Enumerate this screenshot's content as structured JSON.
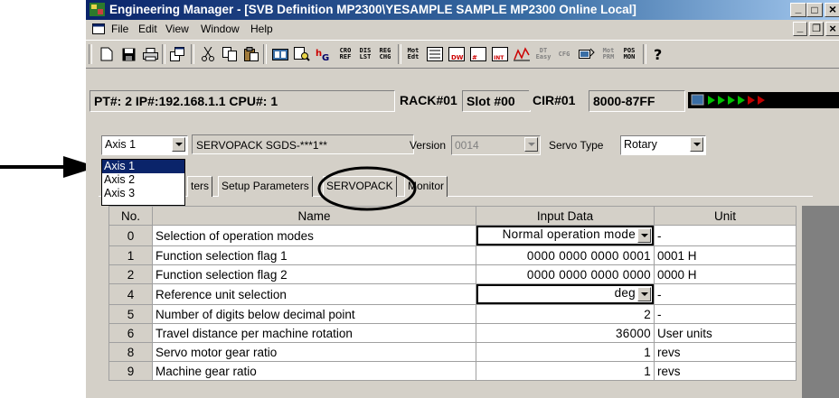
{
  "window": {
    "title": "Engineering Manager - [SVB Definition   MP2300\\YESAMPLE SAMPLE MP2300   Online Local]",
    "controls": {
      "minimize": "_",
      "maximize": "□",
      "close": "×"
    },
    "mdi_controls": {
      "minimize": "_",
      "restore": "❐",
      "close": "×"
    }
  },
  "menu": [
    "File",
    "Edit",
    "View",
    "Window",
    "Help"
  ],
  "toolbar": {
    "labels": {
      "cro_ref": [
        "CRO",
        "REF"
      ],
      "dis_lst": [
        "DIS",
        "LST"
      ],
      "reg_chg": [
        "REG",
        "CHG"
      ],
      "mot_edt": [
        "Mot",
        "Edt"
      ],
      "dt_easy": [
        "DT",
        "Easy"
      ],
      "cfg": "CFG",
      "mot_prm": [
        "Mot",
        "PRM"
      ],
      "pos_mon": [
        "POS",
        "MON"
      ]
    }
  },
  "status": {
    "pt_ip_cpu": "PT#: 2 IP#:192.168.1.1 CPU#: 1",
    "rack": "RACK#01",
    "slot": "Slot #00",
    "cir": "CIR#01",
    "address": "8000-87FF"
  },
  "axis_select": {
    "value": "Axis 1",
    "options": [
      "Axis 1",
      "Axis 2",
      "Axis 3"
    ]
  },
  "servopack_model": "SERVOPACK SGDS-***1**",
  "version": {
    "label": "Version",
    "value": "0014"
  },
  "servo_type": {
    "label": "Servo Type",
    "value": "Rotary"
  },
  "tabs": [
    "ters",
    "Setup Parameters",
    "SERVOPACK",
    "Monitor"
  ],
  "table": {
    "headers": [
      "No.",
      "Name",
      "Input Data",
      "Unit"
    ],
    "rows": [
      {
        "no": "0",
        "name": "Selection of operation modes",
        "input": "Normal operation mode",
        "unit": "-"
      },
      {
        "no": "1",
        "name": "Function selection flag 1",
        "input": "0000 0000 0000 0001",
        "unit": "0001 H"
      },
      {
        "no": "2",
        "name": "Function selection flag 2",
        "input": "0000 0000 0000 0000",
        "unit": "0000 H"
      },
      {
        "no": "4",
        "name": "Reference unit selection",
        "input": "deg",
        "unit": "-"
      },
      {
        "no": "5",
        "name": "Number of digits below decimal point",
        "input": "2",
        "unit": "-"
      },
      {
        "no": "6",
        "name": "Travel distance per machine rotation",
        "input": "36000",
        "unit": "User units"
      },
      {
        "no": "8",
        "name": "Servo motor gear ratio",
        "input": "1",
        "unit": "revs"
      },
      {
        "no": "9",
        "name": "Machine gear ratio",
        "input": "1",
        "unit": "revs"
      }
    ]
  },
  "colors": {
    "title_bar": "#0a246a",
    "face": "#d4d0c8",
    "selection": "#0a246a",
    "annotation": "#000000"
  }
}
